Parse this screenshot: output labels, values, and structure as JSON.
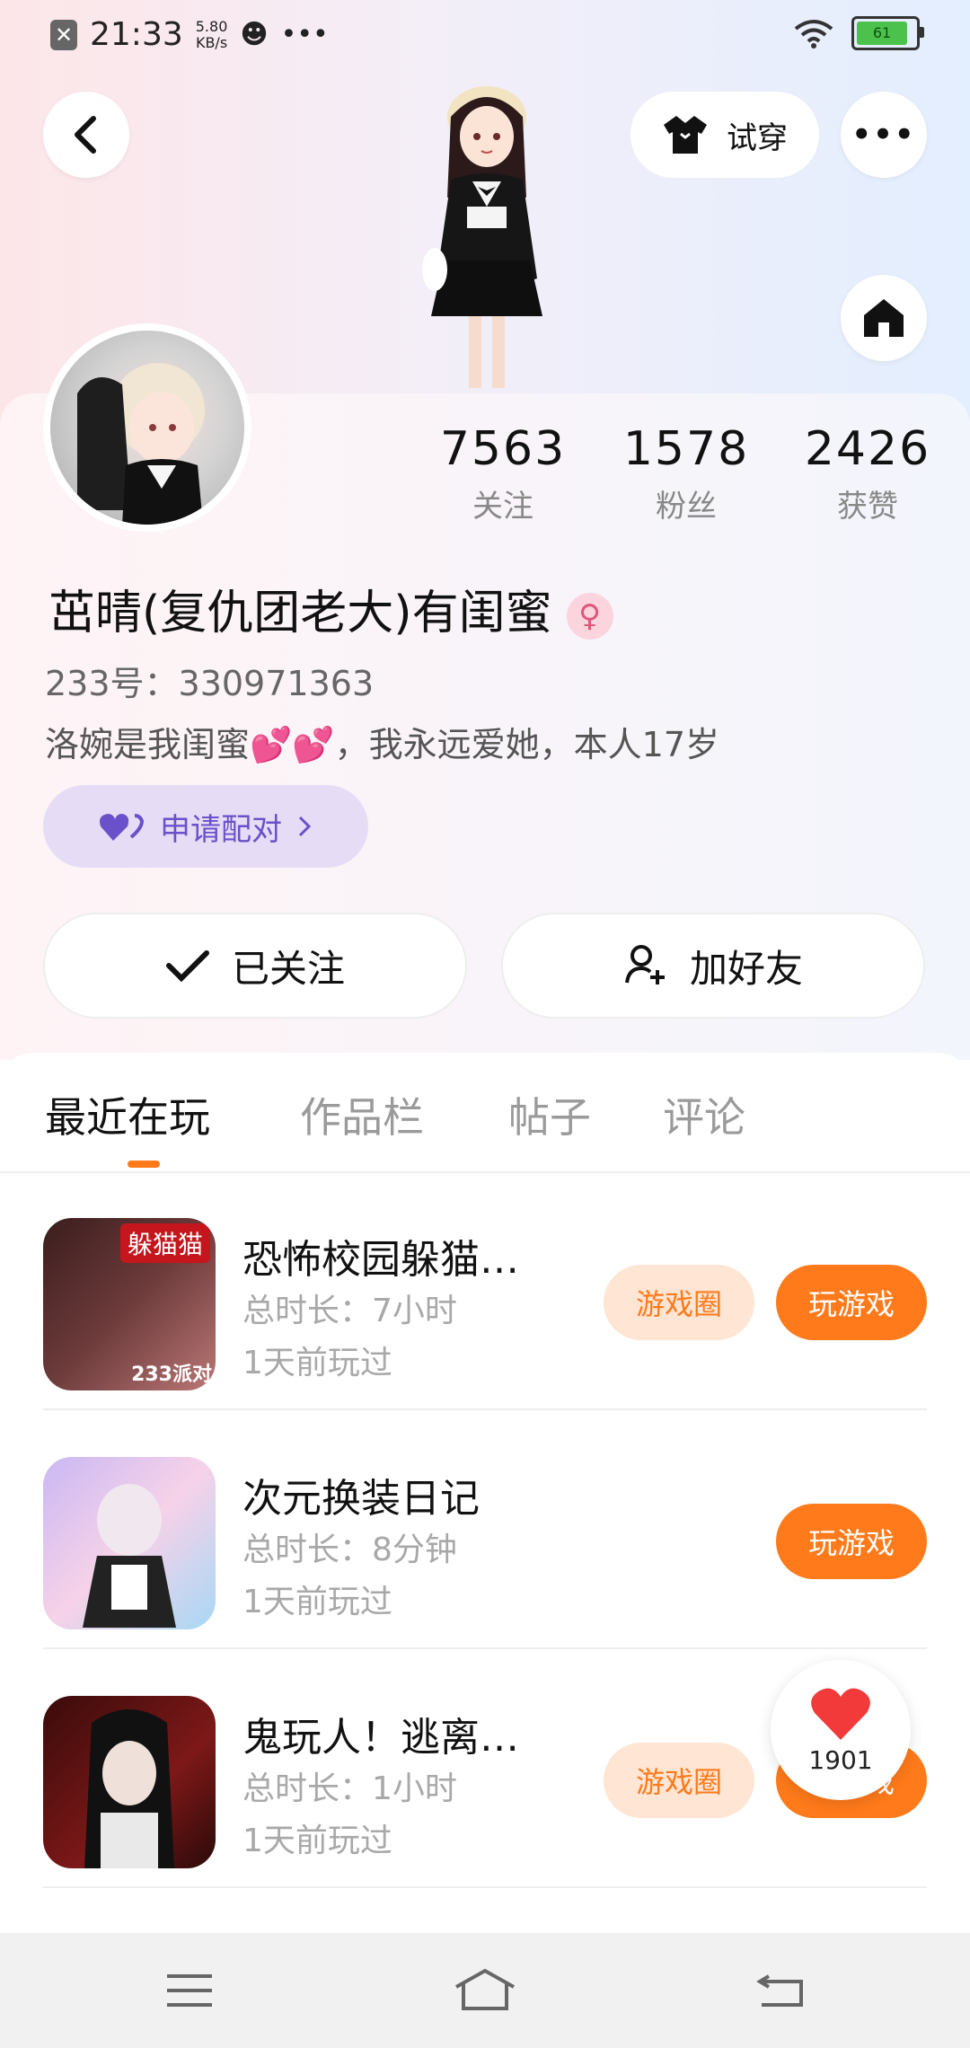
{
  "status_bar": {
    "time": "21:33",
    "speed_value": "5.80",
    "speed_unit": "KB/s",
    "dots": "•••",
    "battery": "61"
  },
  "header": {
    "try_on_label": "试穿",
    "more_label": "•••"
  },
  "profile": {
    "name": "茁晴(复仇团老大)有闺蜜",
    "uid": "233号：330971363",
    "bio_prefix": "洛婉是我闺蜜",
    "bio_suffix": "，我永远爱她，本人17岁",
    "pair_label": "申请配对",
    "stats": [
      {
        "value": "7563",
        "label": "关注"
      },
      {
        "value": "1578",
        "label": "粉丝"
      },
      {
        "value": "2426",
        "label": "获赞"
      }
    ],
    "followed_label": "已关注",
    "add_friend_label": "加好友"
  },
  "tabs": [
    "最近在玩",
    "作品栏",
    "帖子",
    "评论"
  ],
  "games": [
    {
      "title": "恐怖校园躲猫…",
      "duration": "总时长：7小时",
      "last_played": "1天前玩过",
      "circle_label": "游戏圈",
      "play_label": "玩游戏",
      "thumb_text": "躲猫猫",
      "thumb_badge": "233派对"
    },
    {
      "title": "次元换装日记",
      "duration": "总时长：8分钟",
      "last_played": "1天前玩过",
      "circle_label": "",
      "play_label": "玩游戏"
    },
    {
      "title": "鬼玩人！逃离…",
      "duration": "总时长：1小时",
      "last_played": "1天前玩过",
      "circle_label": "游戏圈",
      "play_label": "玩游戏"
    }
  ],
  "float_like": {
    "count": "1901"
  },
  "colors": {
    "accent": "#ff7a1a",
    "pair_bg": "#e6dcf6",
    "pair_text": "#6a51c9"
  }
}
